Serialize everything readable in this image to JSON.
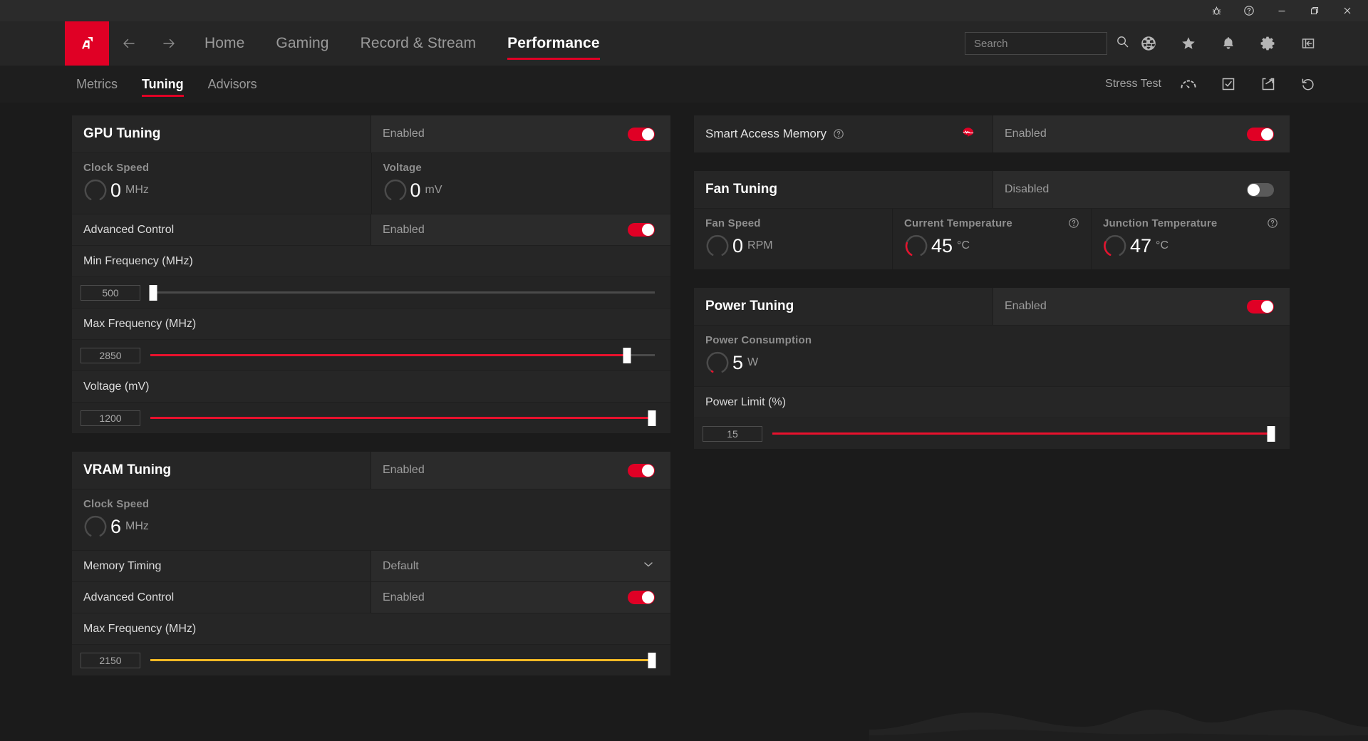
{
  "titlebar": {
    "buttons": [
      {
        "name": "bug-report-icon",
        "label": "Report Bug"
      },
      {
        "name": "help-icon",
        "label": "Help"
      },
      {
        "name": "minimize-icon",
        "label": "Minimize"
      },
      {
        "name": "restore-icon",
        "label": "Restore"
      },
      {
        "name": "close-icon",
        "label": "Close"
      }
    ]
  },
  "nav": {
    "logo_alt": "AMD",
    "back_label": "Back",
    "forward_label": "Forward",
    "items": [
      {
        "label": "Home",
        "active": false
      },
      {
        "label": "Gaming",
        "active": false
      },
      {
        "label": "Record & Stream",
        "active": false
      },
      {
        "label": "Performance",
        "active": true
      }
    ],
    "search": {
      "value": "",
      "placeholder": "Search"
    },
    "icons": [
      {
        "name": "globe-icon",
        "label": "Community"
      },
      {
        "name": "star-icon",
        "label": "Favorites"
      },
      {
        "name": "bell-icon",
        "label": "Notifications"
      },
      {
        "name": "gear-icon",
        "label": "Settings"
      },
      {
        "name": "collapse-panel-icon",
        "label": "Collapse"
      }
    ]
  },
  "subnav": {
    "tabs": [
      {
        "label": "Metrics",
        "active": false
      },
      {
        "label": "Tuning",
        "active": true
      },
      {
        "label": "Advisors",
        "active": false
      }
    ],
    "stress_test_label": "Stress Test",
    "stress_test_icon": "gauge-icon",
    "actions": [
      {
        "name": "load-profile-icon",
        "label": "Load Profile"
      },
      {
        "name": "export-profile-icon",
        "label": "Export Profile"
      },
      {
        "name": "reset-icon",
        "label": "Reset"
      }
    ]
  },
  "colors": {
    "accent_red": "#e00025",
    "slider_red": "#e8112d",
    "slider_yellow": "#f2b824",
    "toggle_off": "#5a5a5a",
    "panel": "#262626",
    "panel_alt": "#2b2b2b"
  },
  "gpu_tuning": {
    "title": "GPU Tuning",
    "state": "Enabled",
    "enabled": true,
    "gauges": [
      {
        "label": "Clock Speed",
        "value": "0",
        "unit": "MHz",
        "fill": 0
      },
      {
        "label": "Voltage",
        "value": "0",
        "unit": "mV",
        "fill": 0
      }
    ],
    "advanced_control": {
      "label": "Advanced Control",
      "state": "Enabled",
      "enabled": true
    },
    "sliders": [
      {
        "label": "Min Frequency (MHz)",
        "value": "500",
        "percent": 0.5,
        "color": "none"
      },
      {
        "label": "Max Frequency (MHz)",
        "value": "2850",
        "percent": 94.5,
        "color": "red"
      },
      {
        "label": "Voltage (mV)",
        "value": "1200",
        "percent": 99.5,
        "color": "red"
      }
    ]
  },
  "vram_tuning": {
    "title": "VRAM Tuning",
    "state": "Enabled",
    "enabled": true,
    "gauges": [
      {
        "label": "Clock Speed",
        "value": "6",
        "unit": "MHz",
        "fill": 0
      }
    ],
    "memory_timing": {
      "label": "Memory Timing",
      "value": "Default"
    },
    "advanced_control": {
      "label": "Advanced Control",
      "state": "Enabled",
      "enabled": true
    },
    "sliders": [
      {
        "label": "Max Frequency (MHz)",
        "value": "2150",
        "percent": 99.5,
        "color": "yellow"
      }
    ]
  },
  "smart_access_memory": {
    "title": "Smart Access Memory",
    "help": true,
    "badge_icon": "amd-brain-icon",
    "state": "Enabled",
    "enabled": true
  },
  "fan_tuning": {
    "title": "Fan Tuning",
    "state": "Disabled",
    "enabled": false,
    "gauges": [
      {
        "label": "Fan Speed",
        "value": "0",
        "unit": "RPM",
        "fill": 0,
        "help": false
      },
      {
        "label": "Current Temperature",
        "value": "45",
        "unit": "°C",
        "fill": 22,
        "help": true
      },
      {
        "label": "Junction Temperature",
        "value": "47",
        "unit": "°C",
        "fill": 24,
        "help": true
      }
    ]
  },
  "power_tuning": {
    "title": "Power Tuning",
    "state": "Enabled",
    "enabled": true,
    "gauges": [
      {
        "label": "Power Consumption",
        "value": "5",
        "unit": "W",
        "fill": 3
      }
    ],
    "sliders": [
      {
        "label": "Power Limit (%)",
        "value": "15",
        "percent": 99.5,
        "color": "red"
      }
    ]
  }
}
